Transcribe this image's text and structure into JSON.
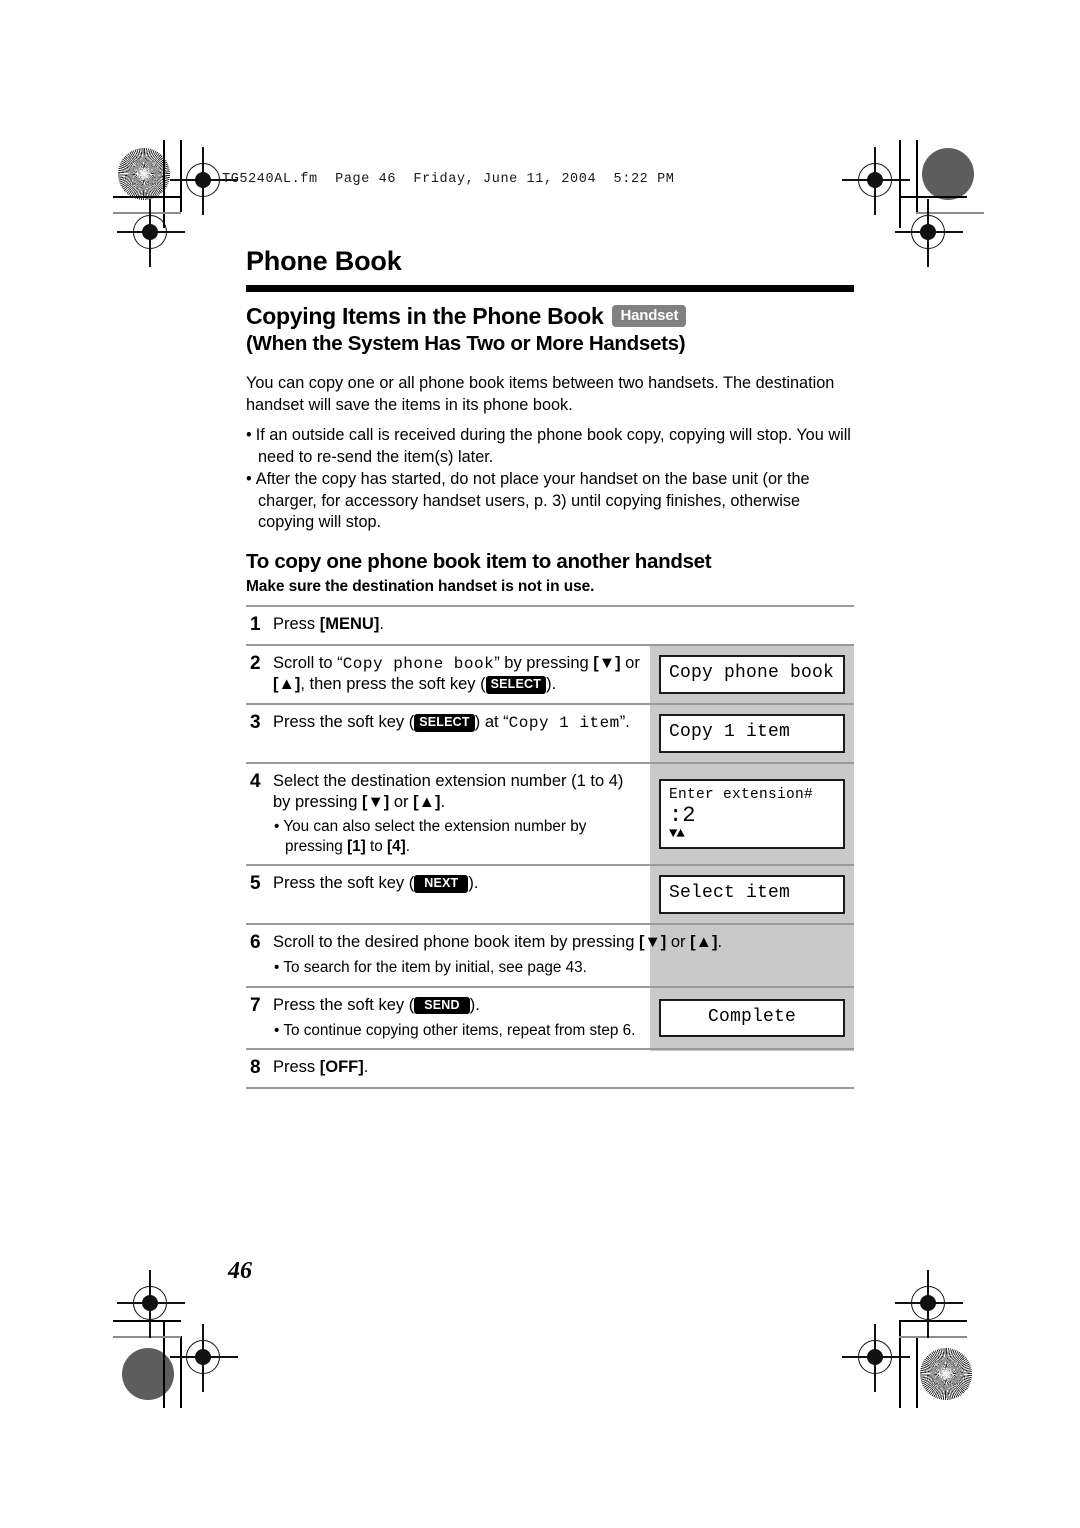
{
  "print_header": "TG5240AL.fm  Page 46  Friday, June 11, 2004  5:22 PM",
  "chapter_title": "Phone Book",
  "section": {
    "title": "Copying Items in the Phone Book",
    "badge": "Handset",
    "subtitle": "(When the System Has Two or More Handsets)"
  },
  "intro": "You can copy one or all phone book items between two handsets. The destination handset will save the items in its phone book.",
  "bullets": [
    "If an outside call is received during the phone book copy, copying will stop. You will need to re-send the item(s) later.",
    "After the copy has started, do not place your handset on the base unit (or the charger, for accessory handset users, p. 3) until copying finishes, otherwise copying will stop."
  ],
  "howto_title": "To copy one phone book item to another handset",
  "howto_note": "Make sure the destination handset is not in use.",
  "steps": [
    {
      "num": "1",
      "text_html": "Press <b>[MENU]</b>.",
      "substeps": [],
      "lcd": null
    },
    {
      "num": "2",
      "text_html": "Scroll to “<span class=\"lcdfont\">Copy phone book</span>” by pressing <b>[▼]</b> or <b>[▲]</b>, then press the soft key (<span class=\"softkey\">SELECT</span>).",
      "substeps": [],
      "lcd": {
        "lines": [
          "Copy phone book"
        ],
        "align": "left",
        "style": "one-line"
      }
    },
    {
      "num": "3",
      "text_html": "Press the soft key (<span class=\"softkey\">SELECT</span>) at “<span class=\"lcdfont\">Copy 1 item</span>”.",
      "substeps": [],
      "lcd": {
        "lines": [
          "Copy 1 item"
        ],
        "align": "left",
        "style": "one-line"
      }
    },
    {
      "num": "4",
      "text_html": "Select the destination extension number (1 to 4) by pressing <b>[▼]</b> or <b>[▲]</b>.",
      "substeps": [
        "You can also select the extension number by pressing <b>[1]</b> to <b>[4]</b>."
      ],
      "lcd": {
        "lines": [
          "Enter extension#",
          ":2",
          "▼▲"
        ],
        "align": "left",
        "style": "three-line"
      }
    },
    {
      "num": "5",
      "text_html": "Press the soft key (<span class=\"softkey wide\">NEXT</span>).",
      "substeps": [],
      "lcd": {
        "lines": [
          "Select item"
        ],
        "align": "left",
        "style": "one-line"
      }
    },
    {
      "num": "6",
      "text_html": "Scroll to the desired phone book item by pressing <b>[▼]</b> or <b>[▲]</b>.",
      "substeps": [
        "To search for the item by initial, see page 43."
      ],
      "lcd": null
    },
    {
      "num": "7",
      "text_html": "Press the soft key (<span class=\"softkey wide\">SEND</span>).",
      "substeps": [
        "To continue copying other items, repeat from step 6."
      ],
      "lcd": {
        "lines": [
          "Complete"
        ],
        "align": "center",
        "style": "one-line"
      }
    },
    {
      "num": "8",
      "text_html": "Press <b>[OFF]</b>.",
      "substeps": [],
      "lcd": null
    }
  ],
  "page_number": "46",
  "colors": {
    "handset_badge_bg": "#808080",
    "softkey_bg": "#000000",
    "lcd_band_bg": "#c9c9c9",
    "rule": "#9a9a9a"
  }
}
